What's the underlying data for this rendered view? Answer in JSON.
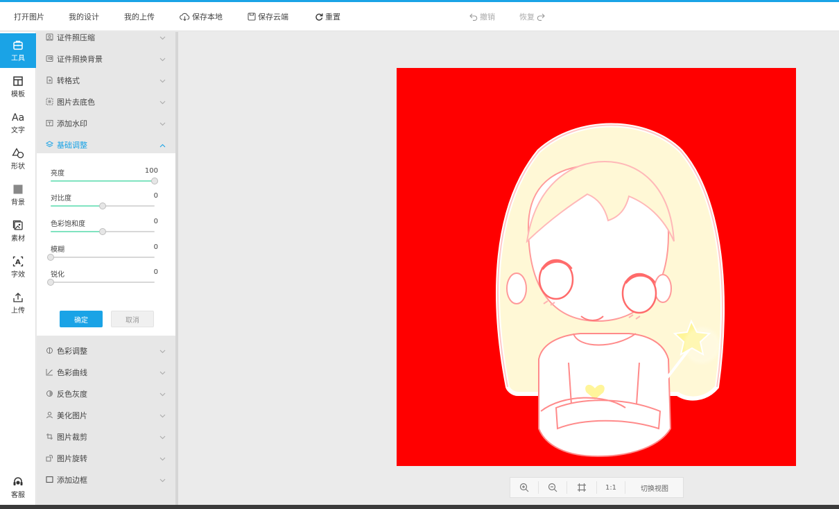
{
  "toolbar": {
    "open_image": "打开图片",
    "my_designs": "我的设计",
    "my_uploads": "我的上传",
    "save_local": "保存本地",
    "save_cloud": "保存云端",
    "reset": "重置",
    "undo": "撤销",
    "redo": "恢复"
  },
  "rail": {
    "items": [
      {
        "label": "工具",
        "icon": "toolbox-icon"
      },
      {
        "label": "模板",
        "icon": "template-icon"
      },
      {
        "label": "文字",
        "icon": "text-icon"
      },
      {
        "label": "形状",
        "icon": "shape-icon"
      },
      {
        "label": "背景",
        "icon": "background-icon"
      },
      {
        "label": "素材",
        "icon": "material-icon"
      },
      {
        "label": "字效",
        "icon": "text-effect-icon"
      },
      {
        "label": "上传",
        "icon": "upload-icon"
      }
    ],
    "service": "客服"
  },
  "panel": {
    "top_items": [
      "证件照压缩",
      "证件照换背景",
      "转格式",
      "图片去底色",
      "添加水印",
      "基础调整"
    ],
    "bottom_items": [
      "色彩调整",
      "色彩曲线",
      "反色灰度",
      "美化图片",
      "图片裁剪",
      "图片旋转",
      "添加边框"
    ],
    "adjust": {
      "sliders": [
        {
          "label": "亮度",
          "value": "100",
          "level": 1.0,
          "filled": true
        },
        {
          "label": "对比度",
          "value": "0",
          "level": 0.5,
          "filled": true
        },
        {
          "label": "色彩饱和度",
          "value": "0",
          "level": 0.5,
          "filled": true
        },
        {
          "label": "模糊",
          "value": "0",
          "level": 0.0,
          "filled": false
        },
        {
          "label": "锐化",
          "value": "0",
          "level": 0.0,
          "filled": false
        }
      ],
      "confirm": "确定",
      "cancel": "取消"
    }
  },
  "canvas": {
    "background": "#ff0000"
  },
  "zoom": {
    "ratio": "1:1",
    "switch_view": "切换视图"
  },
  "colors": {
    "accent": "#1aa3e6",
    "slider_fill": "#7fe3c0"
  }
}
